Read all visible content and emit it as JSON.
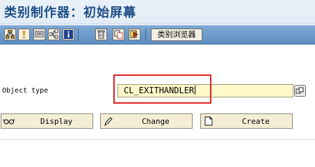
{
  "window": {
    "title": "类别制作器：初始屏幕"
  },
  "toolbar": {
    "buttons": [
      {
        "name": "other-object",
        "icon": "hierarchy-icon"
      },
      {
        "name": "info",
        "icon": "exclamation-icon"
      },
      {
        "name": "where-used",
        "icon": "list-icon"
      },
      {
        "name": "navigate",
        "icon": "tree-icon"
      },
      {
        "name": "information",
        "icon": "info-i-icon"
      },
      {
        "name": "delete",
        "icon": "trash-icon"
      },
      {
        "name": "copy",
        "icon": "copy-icon"
      },
      {
        "name": "activate",
        "icon": "activate-icon"
      }
    ],
    "class_browser_label": "类别浏览器"
  },
  "form": {
    "object_type_label": "Object type",
    "object_type_value": "CL_EXITHANDLER"
  },
  "actions": {
    "display_label": "Display",
    "change_label": "Change",
    "create_label": "Create"
  },
  "colors": {
    "title_text": "#1f4f88",
    "toolbar_bg": "#6f9bcb",
    "input_bg": "#fff9c9",
    "highlight_border": "#e02020",
    "button_bg": "#f5eed6"
  }
}
